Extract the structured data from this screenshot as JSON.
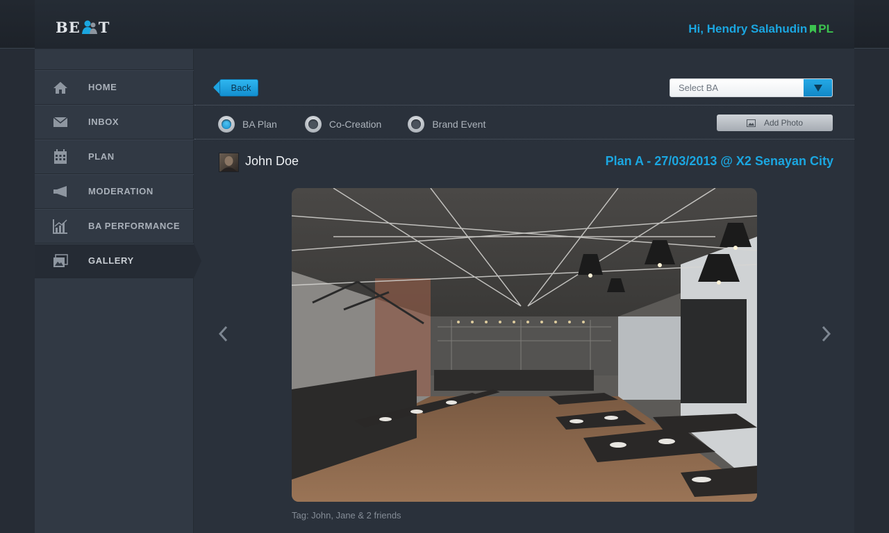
{
  "header": {
    "logo_text_left": "BE",
    "logo_text_right": "T",
    "greeting": "Hi, Hendry Salahudin",
    "role": "PL",
    "accent_color": "#1ba6e0",
    "role_color": "#3cc24f"
  },
  "sidebar": {
    "items": [
      {
        "label": "HOME",
        "icon": "home-icon"
      },
      {
        "label": "INBOX",
        "icon": "envelope-icon"
      },
      {
        "label": "PLAN",
        "icon": "calendar-icon"
      },
      {
        "label": "MODERATION",
        "icon": "megaphone-icon"
      },
      {
        "label": "BA PERFORMANCE",
        "icon": "bar-chart-icon"
      },
      {
        "label": "GALLERY",
        "icon": "gallery-icon",
        "active": true
      }
    ]
  },
  "toolbar": {
    "back_label": "Back",
    "select_ba_value": "Select BA",
    "add_photo_label": "Add Photo"
  },
  "filters": {
    "options": [
      {
        "label": "BA Plan",
        "checked": true
      },
      {
        "label": "Co-Creation",
        "checked": false
      },
      {
        "label": "Brand Event",
        "checked": false
      }
    ]
  },
  "post": {
    "author": "John Doe",
    "plan_title": "Plan A - 27/03/2013 @ X2 Senayan City",
    "tags": "Tag: John, Jane & 2 friends"
  }
}
